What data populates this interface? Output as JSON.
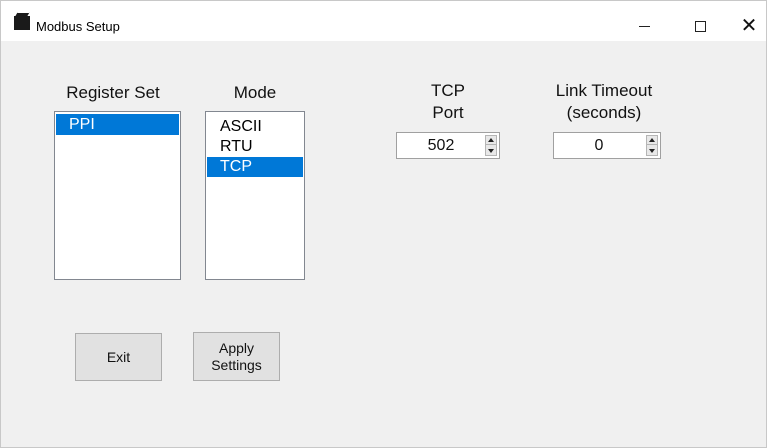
{
  "window": {
    "title": "Modbus Setup",
    "icon": "app-icon"
  },
  "caption_buttons": {
    "minimize": "minimize-icon",
    "maximize": "maximize-icon",
    "close": "close-icon",
    "close_glyph": "✕"
  },
  "register_set": {
    "label": "Register Set",
    "items": [
      "PPI"
    ],
    "selected": "PPI"
  },
  "mode": {
    "label": "Mode",
    "items": [
      "ASCII",
      "RTU",
      "TCP"
    ],
    "selected": "TCP"
  },
  "tcp_port": {
    "label_line1": "TCP",
    "label_line2": "Port",
    "value": "502"
  },
  "link_timeout": {
    "label_line1": "Link Timeout",
    "label_line2": "(seconds)",
    "value": "0"
  },
  "buttons": {
    "exit": "Exit",
    "apply_line1": "Apply",
    "apply_line2": "Settings"
  },
  "colors": {
    "selection": "#0078d7",
    "window_bg": "#f0f0f0",
    "titlebar_bg": "#ffffff"
  }
}
